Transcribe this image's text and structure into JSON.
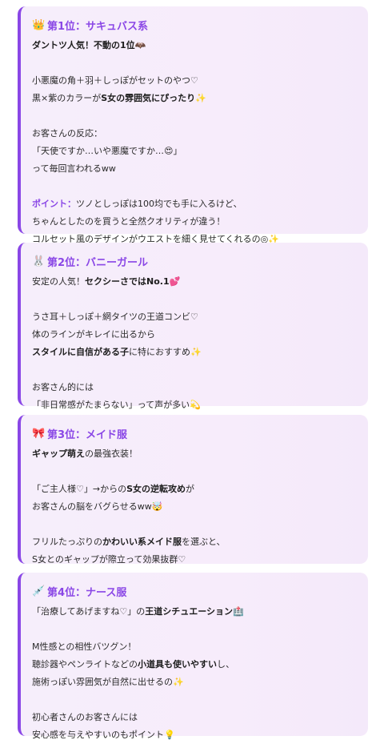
{
  "cards": [
    {
      "emoji": "👑",
      "title": "第1位：サキュバス系",
      "l1": "ダントツ人気！不動の1位🦇",
      "l2": "小悪魔の角＋羽＋しっぽがセットのやつ♡",
      "l3a": "黒×紫のカラーが",
      "l3b": "S女の雰囲気にぴったり",
      "l3c": "✨",
      "l4": "お客さんの反応：",
      "l5": "「天使ですか…いや悪魔ですか…😍」",
      "l6": "って毎回言われるww",
      "l7a": "ポイント：",
      "l7b": "ツノとしっぽは100均でも手に入るけど、",
      "l8": "ちゃんとしたのを買うと全然クオリティが違う！",
      "l9": "コルセット風のデザインがウエストを細く見せてくれるの◎✨"
    },
    {
      "emoji": "🐰",
      "title": "第2位：バニーガール",
      "l1a": "安定の人気！",
      "l1b": "セクシーさではNo.1",
      "l1c": "💕",
      "l2": "うさ耳＋しっぽ＋網タイツの王道コンビ♡",
      "l3": "体のラインがキレイに出るから",
      "l4a": "スタイルに自信がある子",
      "l4b": "に特におすすめ✨",
      "l5": "お客さん的には",
      "l6": "「非日常感がたまらない」って声が多い💫"
    },
    {
      "emoji": "🎀",
      "title": "第3位：メイド服",
      "l1a": "ギャップ萌え",
      "l1b": "の最強衣装！",
      "l2a": "「ご主人様♡」→からの",
      "l2b": "S女の逆転攻め",
      "l2c": "が",
      "l3": "お客さんの脳をバグらせるww🤯",
      "l4a": "フリルたっぷりの",
      "l4b": "かわいい系メイド服",
      "l4c": "を選ぶと、",
      "l5": "S女とのギャップが際立って効果抜群♡"
    },
    {
      "emoji": "💉",
      "title": "第4位：ナース服",
      "l1a": "「治療してあげますね♡」の",
      "l1b": "王道シチュエーション",
      "l1c": "🏥",
      "l2": "M性感との相性バツグン！",
      "l3a": "聴診器やペンライトなどの",
      "l3b": "小道具も使いやすい",
      "l3c": "し、",
      "l4": "施術っぽい雰囲気が自然に出せるの✨",
      "l5": "初心者さんのお客さんには",
      "l6": "安心感を与えやすいのもポイント💡"
    }
  ]
}
